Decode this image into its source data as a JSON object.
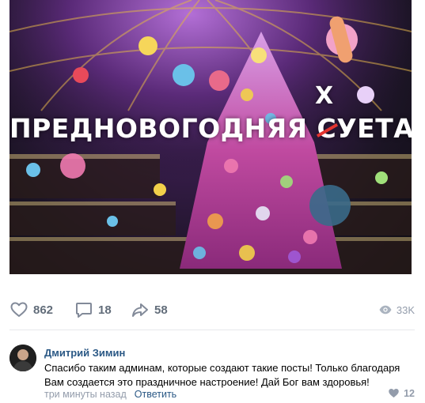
{
  "post": {
    "image": {
      "headline_before": "ПРЕДНОВОГОДНЯЯ ",
      "struck_letter": "С",
      "headline_after": "УЕТА",
      "correction_letter": "Х"
    },
    "actions": {
      "likes": "862",
      "comments": "18",
      "shares": "58",
      "views": "33K"
    }
  },
  "comment": {
    "author": "Дмитрий Зимин",
    "text": "Спасибо таким админам, которые создают такие посты! Только благодаря Вам создается это праздничное настроение! Дай Бог вам здоровья!",
    "time": "три минуты назад",
    "reply_label": "Ответить",
    "likes": "12"
  },
  "icons": {
    "like": "heart-icon",
    "comment": "comment-bubble-icon",
    "share": "share-arrow-icon",
    "views": "eye-icon"
  }
}
